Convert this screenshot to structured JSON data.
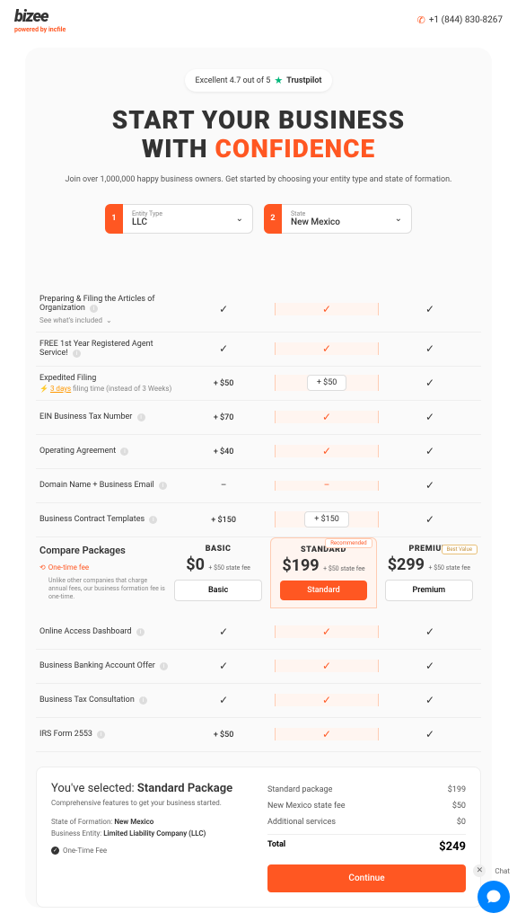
{
  "header": {
    "logo": "bizee",
    "logo_sub_prefix": "powered by ",
    "logo_sub_brand": "incfile",
    "phone": "+1 (844) 830-8267"
  },
  "trustpilot": {
    "text": "Excellent 4.7 out of 5",
    "brand": "Trustpilot"
  },
  "hero": {
    "line1": "START YOUR BUSINESS",
    "line2a": "WITH ",
    "line2b": "CONFIDENCE",
    "sub": "Join over 1,000,000 happy business owners. Get started by choosing your entity type and state of formation."
  },
  "selectors": {
    "entity": {
      "num": "1",
      "label": "Entity Type",
      "value": "LLC"
    },
    "state": {
      "num": "2",
      "label": "State",
      "value": "New Mexico"
    }
  },
  "features": [
    {
      "id": "articles",
      "label": "Preparing & Filing the Articles of Organization",
      "info": true,
      "sublink": "See what's included",
      "basic": "check",
      "std": "check",
      "prem": "check"
    },
    {
      "id": "agent",
      "label": "FREE 1st Year Registered Agent Service!",
      "info": true,
      "basic": "check",
      "std": "check",
      "prem": "check"
    },
    {
      "id": "expedited",
      "label": "Expedited Filing",
      "note": "filing time (instead of 3 Weeks)",
      "note_days": "3 days",
      "basic": "+ $50",
      "std": "pill:+ $50",
      "prem": "check"
    },
    {
      "id": "ein",
      "label": "EIN Business Tax Number",
      "info": true,
      "basic": "+ $70",
      "std": "check",
      "prem": "check"
    },
    {
      "id": "operating",
      "label": "Operating Agreement",
      "info": true,
      "basic": "+ $40",
      "std": "check",
      "prem": "check"
    },
    {
      "id": "domain",
      "label": "Domain Name + Business Email",
      "info": true,
      "basic": "dash",
      "std": "dash",
      "prem": "check"
    },
    {
      "id": "contracts",
      "label": "Business Contract Templates",
      "info": true,
      "basic": "+ $150",
      "std": "pill:+ $150",
      "prem": "check"
    }
  ],
  "compare": {
    "title": "Compare Packages",
    "fee_label": "One-time fee",
    "desc": "Unlike other companies that charge annual fees, our business formation fee is one-time.",
    "packages": {
      "basic": {
        "name": "BASIC",
        "price": "$0",
        "state": "+ $50 state fee",
        "btn": "Basic"
      },
      "standard": {
        "name": "STANDARD",
        "badge": "Recommended",
        "price": "$199",
        "state": "+ $50 state fee",
        "btn": "Standard"
      },
      "premium": {
        "name": "PREMIUM",
        "badge": "Best Value",
        "price": "$299",
        "state": "+ $50 state fee",
        "btn": "Premium"
      }
    }
  },
  "features2": [
    {
      "id": "dashboard",
      "label": "Online Access Dashboard",
      "info": true,
      "basic": "check",
      "std": "check",
      "prem": "check"
    },
    {
      "id": "banking",
      "label": "Business Banking Account Offer",
      "info": true,
      "basic": "check",
      "std": "check",
      "prem": "check"
    },
    {
      "id": "taxconsult",
      "label": "Business Tax Consultation",
      "info": true,
      "basic": "check",
      "std": "check",
      "prem": "check"
    },
    {
      "id": "irs2553",
      "label": "IRS Form 2553",
      "info": true,
      "basic": "+ $50",
      "std": "check",
      "prem": "check"
    }
  ],
  "summary": {
    "title_prefix": "You've selected: ",
    "title_value": "Standard Package",
    "sub": "Comprehensive features to get your business started.",
    "state_label": "State of Formation: ",
    "state_value": "New Mexico",
    "entity_label": "Business Entity: ",
    "entity_value": "Limited Liability Company (LLC)",
    "onetime": "One-Time Fee",
    "lines": [
      {
        "l": "Standard package",
        "v": "$199"
      },
      {
        "l": "New Mexico state fee",
        "v": "$50"
      },
      {
        "l": "Additional services",
        "v": "$0"
      }
    ],
    "total_label": "Total",
    "total_value": "$249",
    "continue": "Continue"
  },
  "chat": {
    "label": "Chat"
  }
}
